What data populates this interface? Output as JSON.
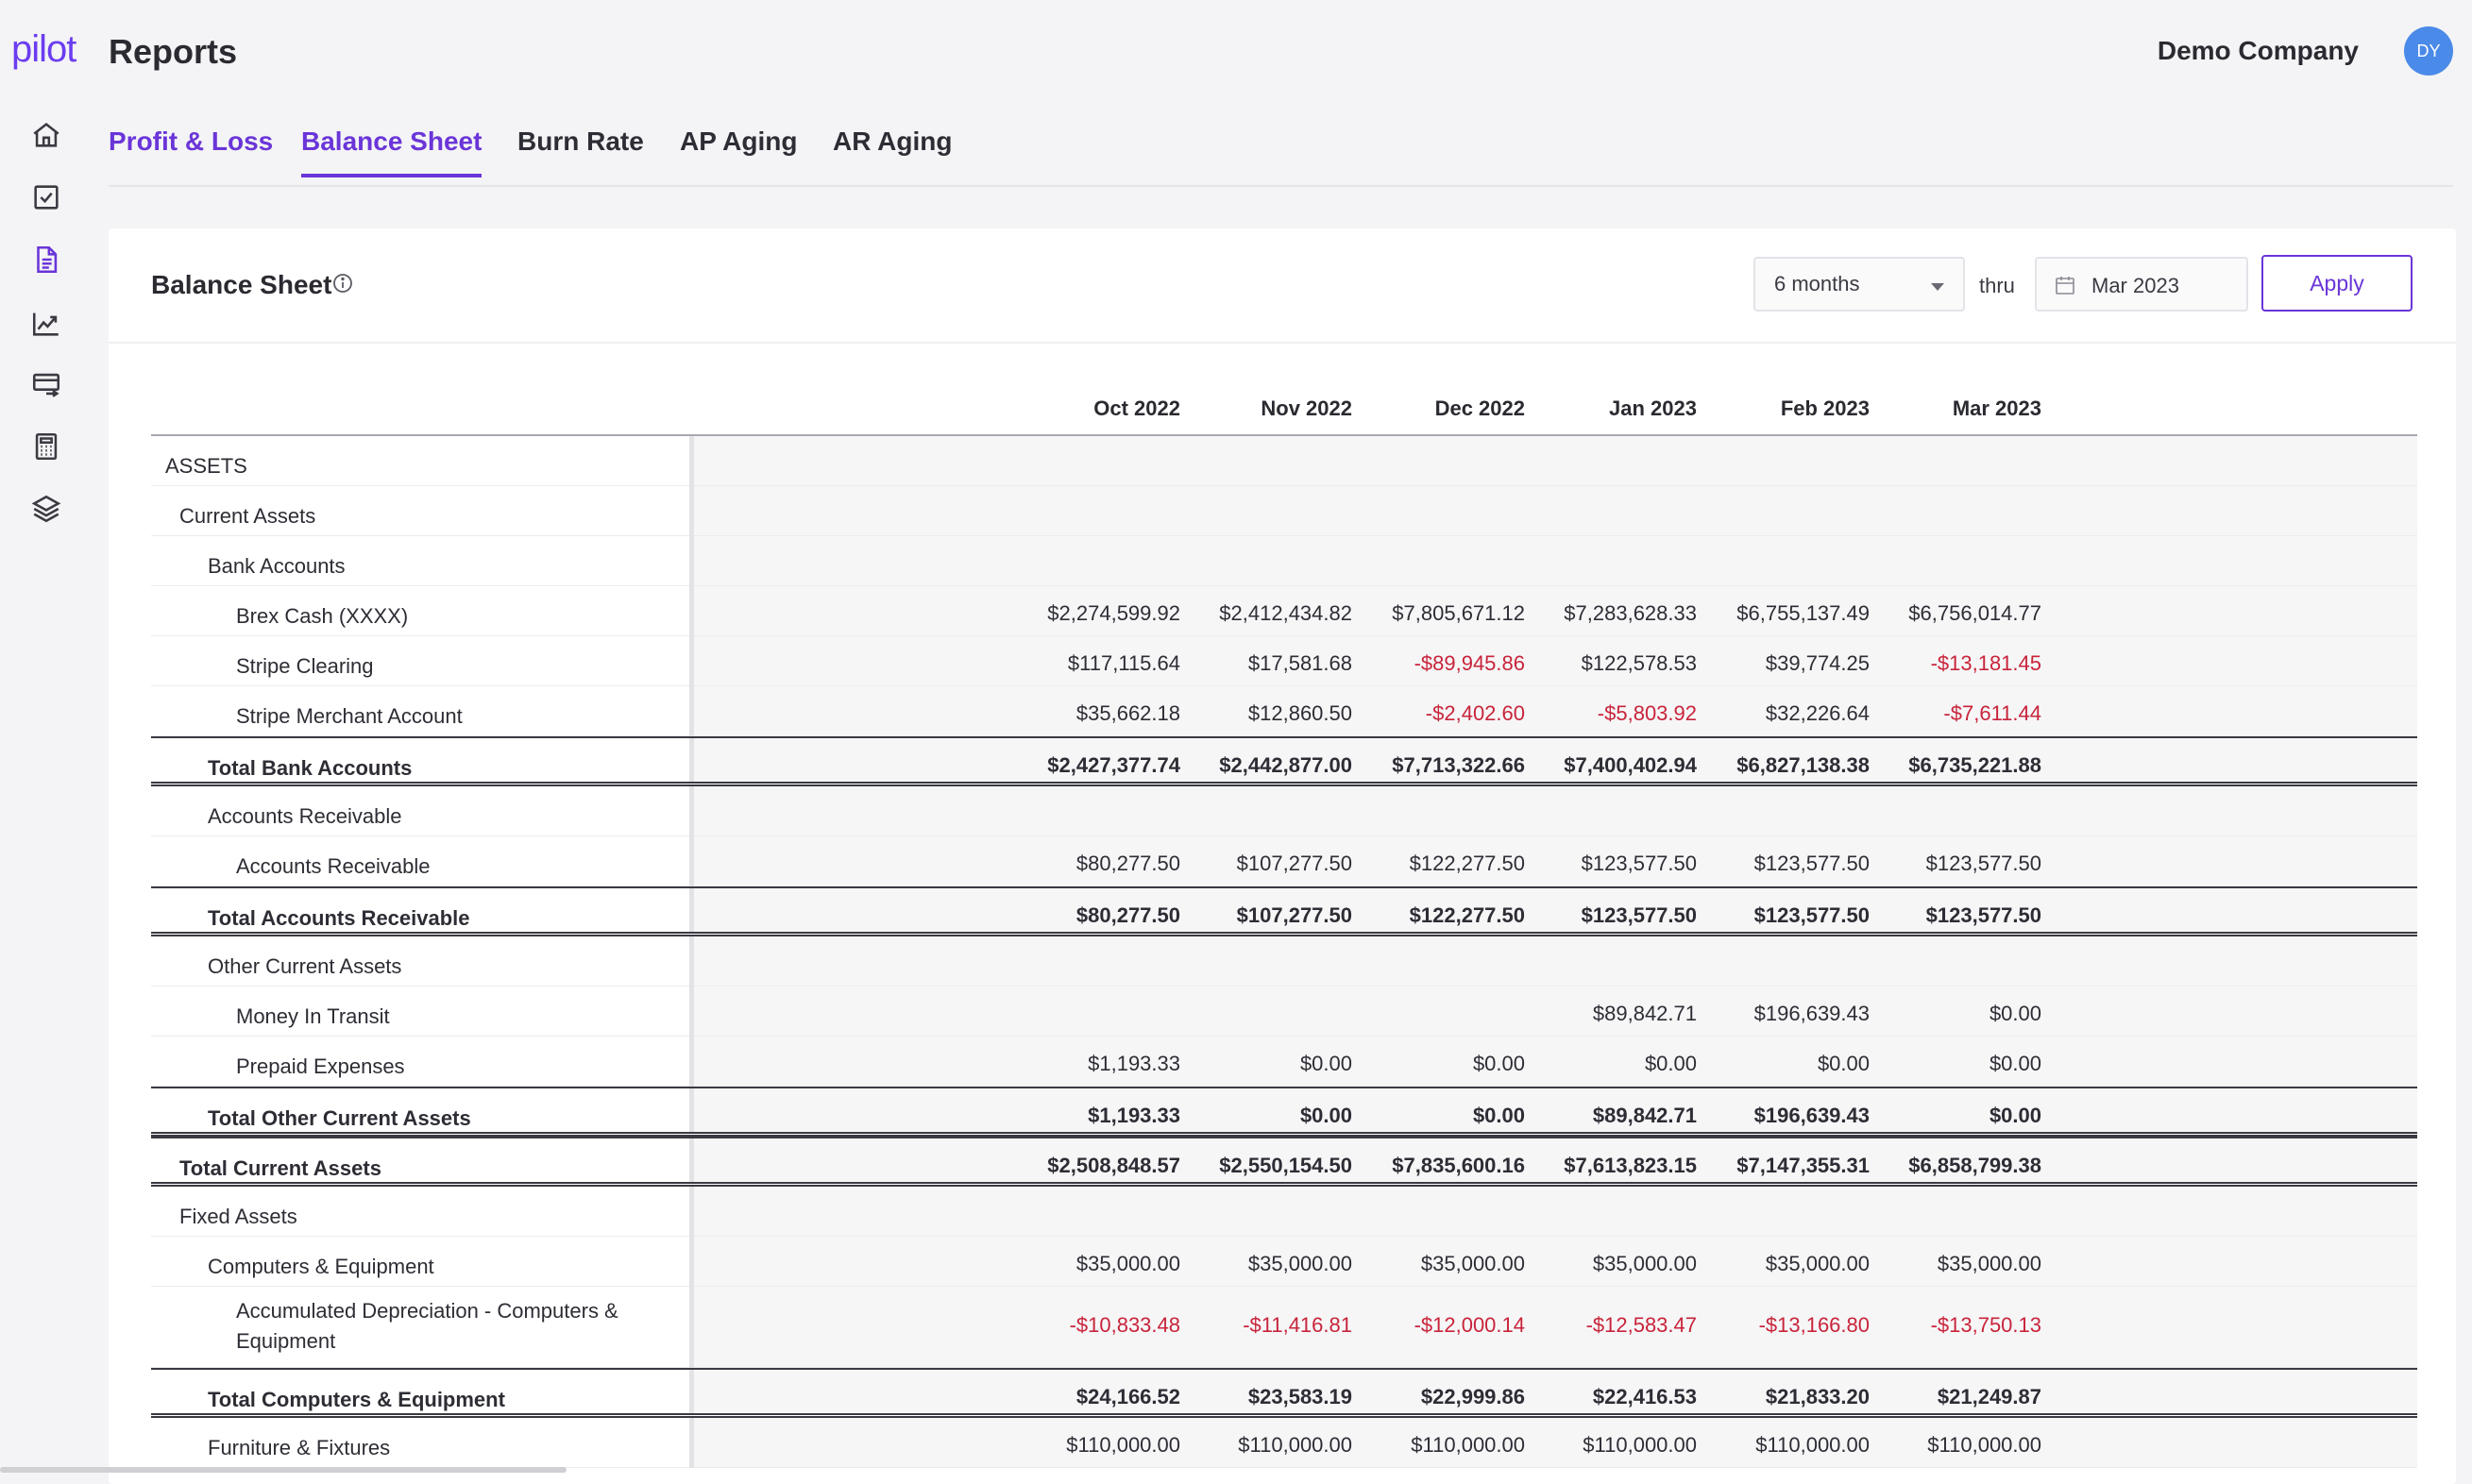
{
  "app": {
    "logo": "pilot",
    "title": "Reports",
    "company": "Demo Company",
    "avatar_initials": "DY"
  },
  "sidebar_icons": [
    "home-icon",
    "checkbox-icon",
    "document-icon",
    "trend-chart-icon",
    "card-transfer-icon",
    "calculator-icon",
    "layers-icon"
  ],
  "tabs": [
    {
      "label": "Profit & Loss",
      "state": "purple"
    },
    {
      "label": "Balance Sheet",
      "state": "active"
    },
    {
      "label": "Burn Rate",
      "state": "default"
    },
    {
      "label": "AP Aging",
      "state": "default"
    },
    {
      "label": "AR Aging",
      "state": "default"
    }
  ],
  "report": {
    "title": "Balance Sheet",
    "period_select": "6 months",
    "thru_label": "thru",
    "end_date": "Mar 2023",
    "apply_label": "Apply"
  },
  "colors": {
    "accent": "#6a35d8",
    "negative": "#c8243a",
    "avatar": "#4a8ae8"
  },
  "columns": [
    "Oct 2022",
    "Nov 2022",
    "Dec 2022",
    "Jan 2023",
    "Feb 2023",
    "Mar 2023"
  ],
  "rows": [
    {
      "label": "ASSETS",
      "indent": 0,
      "values": [
        "",
        "",
        "",
        "",
        "",
        ""
      ]
    },
    {
      "label": "Current Assets",
      "indent": 1,
      "values": [
        "",
        "",
        "",
        "",
        "",
        ""
      ]
    },
    {
      "label": "Bank Accounts",
      "indent": 2,
      "values": [
        "",
        "",
        "",
        "",
        "",
        ""
      ]
    },
    {
      "label": "Brex Cash (XXXX)",
      "indent": 3,
      "values": [
        "$2,274,599.92",
        "$2,412,434.82",
        "$7,805,671.12",
        "$7,283,628.33",
        "$6,755,137.49",
        "$6,756,014.77"
      ]
    },
    {
      "label": "Stripe Clearing",
      "indent": 3,
      "values": [
        "$117,115.64",
        "$17,581.68",
        "-$89,945.86",
        "$122,578.53",
        "$39,774.25",
        "-$13,181.45"
      ]
    },
    {
      "label": "Stripe Merchant Account",
      "indent": 3,
      "values": [
        "$35,662.18",
        "$12,860.50",
        "-$2,402.60",
        "-$5,803.92",
        "$32,226.64",
        "-$7,611.44"
      ]
    },
    {
      "label": "Total Bank Accounts",
      "indent": 2,
      "total": true,
      "values": [
        "$2,427,377.74",
        "$2,442,877.00",
        "$7,713,322.66",
        "$7,400,402.94",
        "$6,827,138.38",
        "$6,735,221.88"
      ]
    },
    {
      "label": "Accounts Receivable",
      "indent": 2,
      "values": [
        "",
        "",
        "",
        "",
        "",
        ""
      ]
    },
    {
      "label": "Accounts Receivable",
      "indent": 3,
      "values": [
        "$80,277.50",
        "$107,277.50",
        "$122,277.50",
        "$123,577.50",
        "$123,577.50",
        "$123,577.50"
      ]
    },
    {
      "label": "Total Accounts Receivable",
      "indent": 2,
      "total": true,
      "values": [
        "$80,277.50",
        "$107,277.50",
        "$122,277.50",
        "$123,577.50",
        "$123,577.50",
        "$123,577.50"
      ]
    },
    {
      "label": "Other Current Assets",
      "indent": 2,
      "values": [
        "",
        "",
        "",
        "",
        "",
        ""
      ]
    },
    {
      "label": "Money In Transit",
      "indent": 3,
      "values": [
        "",
        "",
        "",
        "$89,842.71",
        "$196,639.43",
        "$0.00"
      ]
    },
    {
      "label": "Prepaid Expenses",
      "indent": 3,
      "values": [
        "$1,193.33",
        "$0.00",
        "$0.00",
        "$0.00",
        "$0.00",
        "$0.00"
      ]
    },
    {
      "label": "Total Other Current Assets",
      "indent": 2,
      "total": true,
      "values": [
        "$1,193.33",
        "$0.00",
        "$0.00",
        "$89,842.71",
        "$196,639.43",
        "$0.00"
      ]
    },
    {
      "label": "Total Current Assets",
      "indent": 1,
      "total": true,
      "values": [
        "$2,508,848.57",
        "$2,550,154.50",
        "$7,835,600.16",
        "$7,613,823.15",
        "$7,147,355.31",
        "$6,858,799.38"
      ]
    },
    {
      "label": "Fixed Assets",
      "indent": 1,
      "values": [
        "",
        "",
        "",
        "",
        "",
        ""
      ]
    },
    {
      "label": "Computers & Equipment",
      "indent": 2,
      "values": [
        "$35,000.00",
        "$35,000.00",
        "$35,000.00",
        "$35,000.00",
        "$35,000.00",
        "$35,000.00"
      ]
    },
    {
      "label": "Accumulated Depreciation - Computers & Equipment",
      "indent": 3,
      "tall": true,
      "values": [
        "-$10,833.48",
        "-$11,416.81",
        "-$12,000.14",
        "-$12,583.47",
        "-$13,166.80",
        "-$13,750.13"
      ]
    },
    {
      "label": "Total Computers & Equipment",
      "indent": 2,
      "total": true,
      "values": [
        "$24,166.52",
        "$23,583.19",
        "$22,999.86",
        "$22,416.53",
        "$21,833.20",
        "$21,249.87"
      ]
    },
    {
      "label": "Furniture & Fixtures",
      "indent": 2,
      "values": [
        "$110,000.00",
        "$110,000.00",
        "$110,000.00",
        "$110,000.00",
        "$110,000.00",
        "$110,000.00"
      ]
    }
  ]
}
